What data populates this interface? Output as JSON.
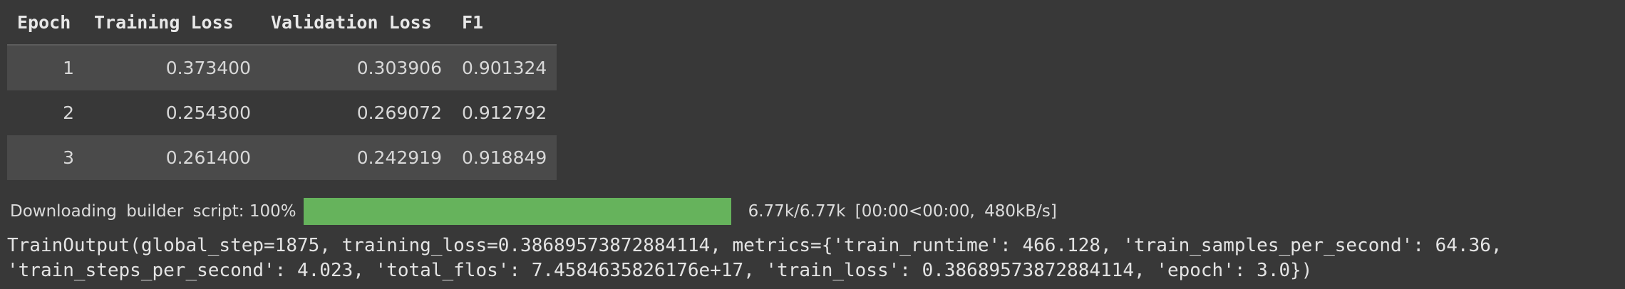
{
  "table": {
    "headers": [
      "Epoch",
      "Training Loss",
      "Validation Loss",
      "F1"
    ],
    "rows": [
      {
        "epoch": "1",
        "training_loss": "0.373400",
        "validation_loss": "0.303906",
        "f1": "0.901324"
      },
      {
        "epoch": "2",
        "training_loss": "0.254300",
        "validation_loss": "0.269072",
        "f1": "0.912792"
      },
      {
        "epoch": "3",
        "training_loss": "0.261400",
        "validation_loss": "0.242919",
        "f1": "0.918849"
      }
    ]
  },
  "progress": {
    "description": "Downloading builder script:",
    "percent_label": "100%",
    "fraction": 1.0,
    "color": "#66b35c",
    "stats": "6.77k/6.77k [00:00<00:00, 480kB/s]"
  },
  "output": {
    "line1": "TrainOutput(global_step=1875, training_loss=0.38689573872884114, metrics={'train_runtime': 466.128, 'train_samples_per_second': 64.36,",
    "line2": "'train_steps_per_second': 4.023, 'total_flos': 7.4584635826176e+17, 'train_loss': 0.38689573872884114, 'epoch': 3.0})"
  }
}
